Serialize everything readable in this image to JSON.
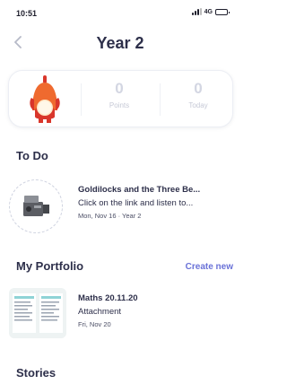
{
  "status_bar": {
    "time": "10:51",
    "network": "4G"
  },
  "nav": {
    "title": "Year 2",
    "back_icon": "chevron-left-icon"
  },
  "stats": {
    "points_value": "0",
    "points_label": "Points",
    "today_value": "0",
    "today_label": "Today"
  },
  "todo": {
    "heading": "To Do",
    "item": {
      "title": "Goldilocks and the Three Be...",
      "subtitle": "Click on the link and listen to...",
      "meta": "Mon, Nov 16 · Year 2",
      "thumb_icon": "video-camera-icon"
    }
  },
  "portfolio": {
    "heading": "My Portfolio",
    "create_label": "Create new",
    "item": {
      "title": "Maths 20.11.20",
      "subtitle": "Attachment",
      "meta": "Fri, Nov 20"
    }
  },
  "stories": {
    "heading": "Stories"
  },
  "colors": {
    "accent": "#6a72d8",
    "text": "#2d2f4a",
    "muted": "#c6c9d6",
    "avatar_orange": "#ef6a2f",
    "avatar_red": "#d9362b"
  }
}
